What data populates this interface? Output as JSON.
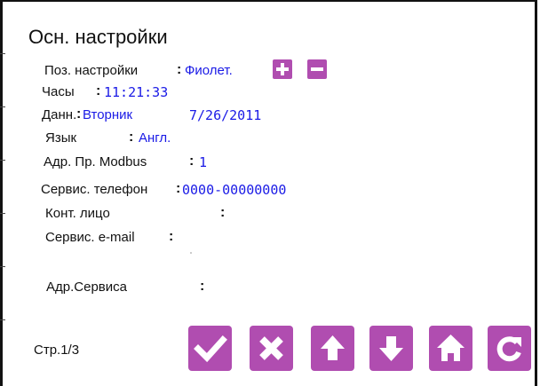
{
  "title": "Осн. настройки",
  "rows": {
    "preset": {
      "label": "Поз. настройки",
      "sep": ":",
      "value": "Фиолет."
    },
    "clock": {
      "label": "Часы",
      "sep": ":",
      "value": "11:21:33"
    },
    "date": {
      "label": "Данн.",
      "sep": ":",
      "day": "Вторник",
      "value": "7/26/2011"
    },
    "language": {
      "label": "Язык",
      "sep": ":",
      "value": "Англ."
    },
    "modbus": {
      "label": "Адр. Пр. Modbus",
      "sep": ":",
      "value": "1"
    },
    "phone": {
      "label": "Сервис. телефон",
      "sep": ":",
      "value": "0000-00000000"
    },
    "contact": {
      "label": "Конт. лицо",
      "sep": ":",
      "value": ""
    },
    "email": {
      "label": "Сервис. e-mail",
      "sep": ":",
      "value": ""
    },
    "address": {
      "label": "Адр.Сервиса",
      "sep": ":",
      "value": ""
    }
  },
  "page_indicator": "Стр.1/3",
  "colors": {
    "button": "#b04db0",
    "value_text": "#1a1ae6"
  },
  "icons": {
    "plus": "plus-icon",
    "minus": "minus-icon",
    "confirm": "checkmark-icon",
    "cancel": "x-icon",
    "up": "arrow-up-icon",
    "down": "arrow-down-icon",
    "home": "home-icon",
    "refresh": "refresh-icon"
  }
}
